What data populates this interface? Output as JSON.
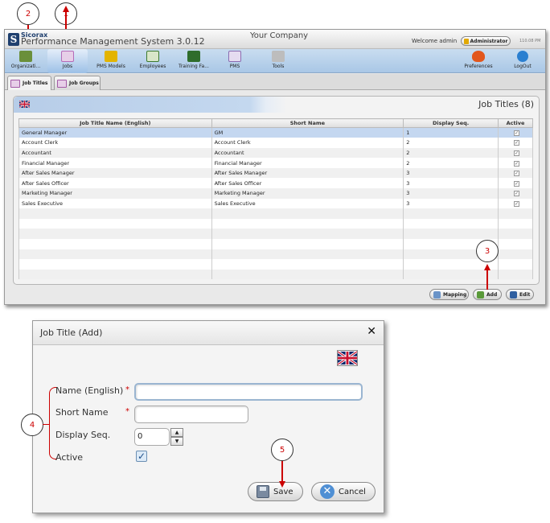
{
  "callouts": [
    "1",
    "2",
    "3",
    "4",
    "5"
  ],
  "app": {
    "brand": "Sicorax",
    "title": "Performance Management System 3.0.12",
    "company": "Your Company",
    "welcome": "Welcome admin",
    "role": "Administrator",
    "clock": "110.08 PM"
  },
  "toolbar": [
    {
      "label": "Organizati...",
      "icon": "organization-icon",
      "color": "#6a8f3a"
    },
    {
      "label": "Jobs",
      "icon": "jobs-icon",
      "color": "#b56bb8"
    },
    {
      "label": "PMS Models",
      "icon": "pms-models-icon",
      "color": "#e3b400"
    },
    {
      "label": "Employees",
      "icon": "employees-icon",
      "color": "#3d7a2e"
    },
    {
      "label": "Training Fa...",
      "icon": "training-icon",
      "color": "#2f6d2b"
    },
    {
      "label": "PMS",
      "icon": "pms-icon",
      "color": "#8a6bb0"
    },
    {
      "label": "Tools",
      "icon": "tools-icon",
      "color": "#888888"
    },
    {
      "label": "Preferences",
      "icon": "heart-icon",
      "color": "#e2561c"
    },
    {
      "label": "LogOut",
      "icon": "power-icon",
      "color": "#2a7fd0"
    }
  ],
  "tabs": [
    {
      "label": "Job Titles"
    },
    {
      "label": "Job Groups"
    }
  ],
  "panel": {
    "title": "Job Titles (8)",
    "columns": [
      "Job Title Name (English)",
      "Short Name",
      "Display Seq.",
      "Active"
    ],
    "rows": [
      {
        "name": "General Manager",
        "short": "GM",
        "seq": "1"
      },
      {
        "name": "Account Clerk",
        "short": "Account Clerk",
        "seq": "2"
      },
      {
        "name": "Accountant",
        "short": "Accountant",
        "seq": "2"
      },
      {
        "name": "Financial Manager",
        "short": "Financial Manager",
        "seq": "2"
      },
      {
        "name": "After Sales Manager",
        "short": "After Sales Manager",
        "seq": "3"
      },
      {
        "name": "After Sales Officer",
        "short": "After Sales Officer",
        "seq": "3"
      },
      {
        "name": "Marketing Manager",
        "short": "Marketing Manager",
        "seq": "3"
      },
      {
        "name": "Sales Executive",
        "short": "Sales Executive",
        "seq": "3"
      }
    ],
    "checkmark": "✓"
  },
  "buttons": {
    "mapping": "Mapping",
    "add": "Add",
    "edit": "Edit"
  },
  "dialog": {
    "title": "Job Title (Add)",
    "close": "✕",
    "name_label": "Name (English)",
    "short_label": "Short Name",
    "seq_label": "Display Seq.",
    "active_label": "Active",
    "required": "*",
    "name_value": "",
    "short_value": "",
    "seq_value": "0",
    "spin_up": "▲",
    "spin_down": "▼",
    "active_check": "✓",
    "save": "Save",
    "cancel": "Cancel"
  }
}
